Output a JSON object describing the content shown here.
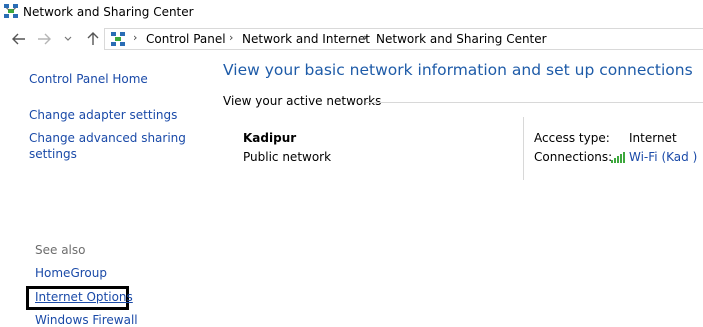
{
  "window": {
    "title": "Network and Sharing Center",
    "icon": "network-center-icon"
  },
  "nav": {
    "back_icon": "arrow-left-icon",
    "forward_icon": "arrow-right-icon",
    "recent_icon": "chevron-down-icon",
    "up_icon": "arrow-up-icon"
  },
  "breadcrumb": {
    "separator": "›",
    "items": [
      "Control Panel",
      "Network and Internet",
      "Network and Sharing Center"
    ]
  },
  "sidebar": {
    "home": "Control Panel Home",
    "tasks": [
      "Change adapter settings",
      "Change advanced sharing",
      "settings"
    ],
    "see_also_label": "See also",
    "see_also": [
      "HomeGroup",
      "Internet Options",
      "Windows Firewall"
    ]
  },
  "main": {
    "heading": "View your basic network information and set up connections",
    "active_networks_label": "View your active networks",
    "network": {
      "name": "Kadipur",
      "category": "Public network",
      "access_type_label": "Access type:",
      "access_type_value": "Internet",
      "connections_label": "Connections:",
      "connection_value": "Wi-Fi (Kad )"
    }
  },
  "colors": {
    "link": "#1a4aa8",
    "heading": "#1e5ba8",
    "muted": "#6d6d6d",
    "wifi": "#3da83d"
  }
}
